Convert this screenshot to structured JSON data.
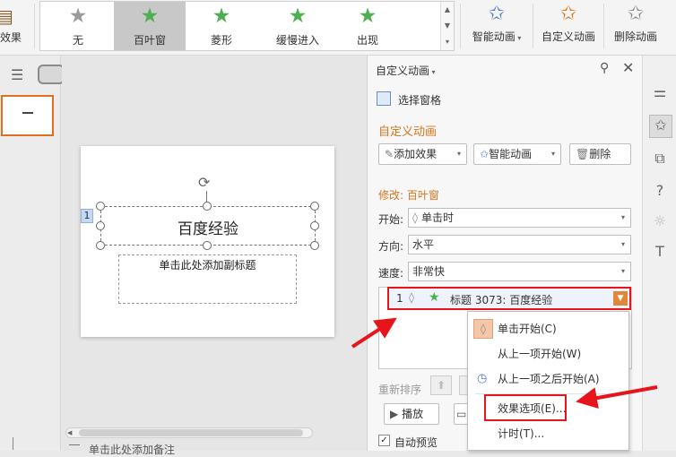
{
  "ribbon": {
    "left_cut_label": "效果",
    "animations": [
      {
        "label": "无",
        "icon": "star-none-icon",
        "color": "#9a9a9a"
      },
      {
        "label": "百叶窗",
        "icon": "star-blinds-icon",
        "color": "#5cb85c"
      },
      {
        "label": "菱形",
        "icon": "star-diamond-icon",
        "color": "#5cb85c"
      },
      {
        "label": "缓慢进入",
        "icon": "star-crawl-icon",
        "color": "#5cb85c"
      },
      {
        "label": "出现",
        "icon": "star-appear-icon",
        "color": "#5cb85c"
      }
    ],
    "selected_animation": "百叶窗",
    "smart_animation": "智能动画",
    "custom_animation": "自定义动画",
    "delete_animation": "删除动画"
  },
  "slide": {
    "title": "百度经验",
    "subtitle_placeholder": "单击此处添加副标题",
    "anim_tag": "1"
  },
  "notes_placeholder": "单击此处添加备注",
  "pane": {
    "header": "自定义动画",
    "selection_pane": "选择窗格",
    "section_title": "自定义动画",
    "add_effect": "添加效果",
    "smart_animation": "智能动画",
    "delete": "删除",
    "modify_label": "修改: 百叶窗",
    "start_label": "开始:",
    "start_value": "单击时",
    "direction_label": "方向:",
    "direction_value": "水平",
    "speed_label": "速度:",
    "speed_value": "非常快",
    "list_item": {
      "index": "1",
      "text": "标题 3073: 百度经验"
    },
    "reorder_label": "重新排序",
    "play": "播放",
    "auto_preview": "自动预览",
    "auto_preview_checked": true
  },
  "context_menu": [
    {
      "label": "单击开始(C)",
      "icon": "mouse-click-icon"
    },
    {
      "label": "从上一项开始(W)",
      "icon": ""
    },
    {
      "label": "从上一项之后开始(A)",
      "icon": "clock-icon"
    },
    {
      "label": "效果选项(E)...",
      "icon": ""
    },
    {
      "label": "计时(T)...",
      "icon": ""
    }
  ],
  "colors": {
    "accent_orange": "#d9731f",
    "highlight_red": "#e8141c",
    "selected_gray": "#c8c8c8"
  }
}
